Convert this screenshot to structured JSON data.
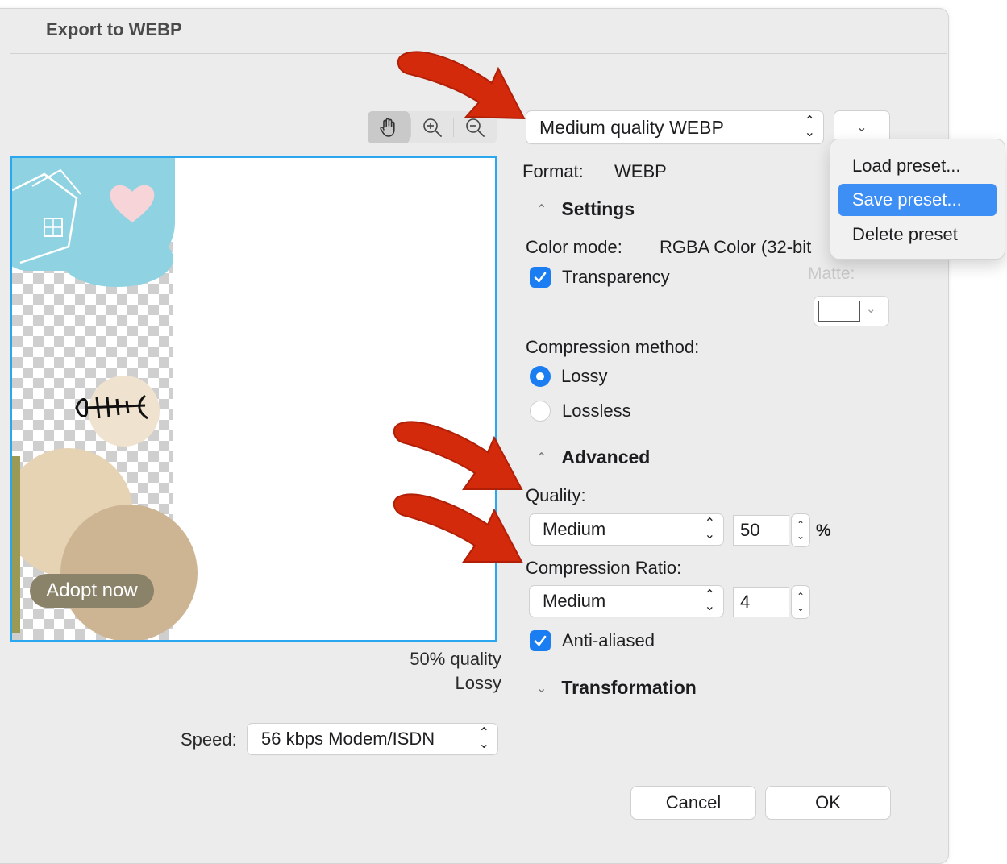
{
  "window": {
    "title": "Export to WEBP"
  },
  "toolbar": {
    "hand_tool": "hand-icon",
    "zoom_in": "zoom-in-icon",
    "zoom_out": "zoom-out-icon"
  },
  "preview": {
    "banner_button": "Adopt now",
    "quality_line1": "50% quality",
    "quality_line2": "Lossy"
  },
  "speed": {
    "label": "Speed:",
    "value": "56 kbps Modem/ISDN"
  },
  "preset": {
    "value": "Medium quality WEBP"
  },
  "preset_menu": {
    "items": [
      {
        "label": "Load preset...",
        "highlighted": false
      },
      {
        "label": "Save preset...",
        "highlighted": true
      },
      {
        "label": "Delete preset",
        "highlighted": false
      }
    ]
  },
  "format": {
    "label": "Format:",
    "value": "WEBP"
  },
  "settings": {
    "header": "Settings",
    "color_mode_label": "Color mode:",
    "color_mode_value": "RGBA Color (32-bit",
    "transparency_label": "Transparency",
    "transparency_checked": true,
    "matte_label": "Matte:",
    "compression_method_label": "Compression method:",
    "lossy_label": "Lossy",
    "lossless_label": "Lossless",
    "selected_method": "Lossy"
  },
  "advanced": {
    "header": "Advanced",
    "quality_label": "Quality:",
    "quality_preset": "Medium",
    "quality_value": "50",
    "quality_unit": "%",
    "compression_ratio_label": "Compression Ratio:",
    "compression_preset": "Medium",
    "compression_value": "4",
    "anti_aliased_label": "Anti-aliased",
    "anti_aliased_checked": true
  },
  "transformation": {
    "header": "Transformation"
  },
  "buttons": {
    "cancel": "Cancel",
    "ok": "OK"
  },
  "colors": {
    "accent": "#1a7ef2",
    "preview_border": "#2aa7ee",
    "arrow": "#d42a0c",
    "menu_highlight": "#3d8ef5"
  }
}
